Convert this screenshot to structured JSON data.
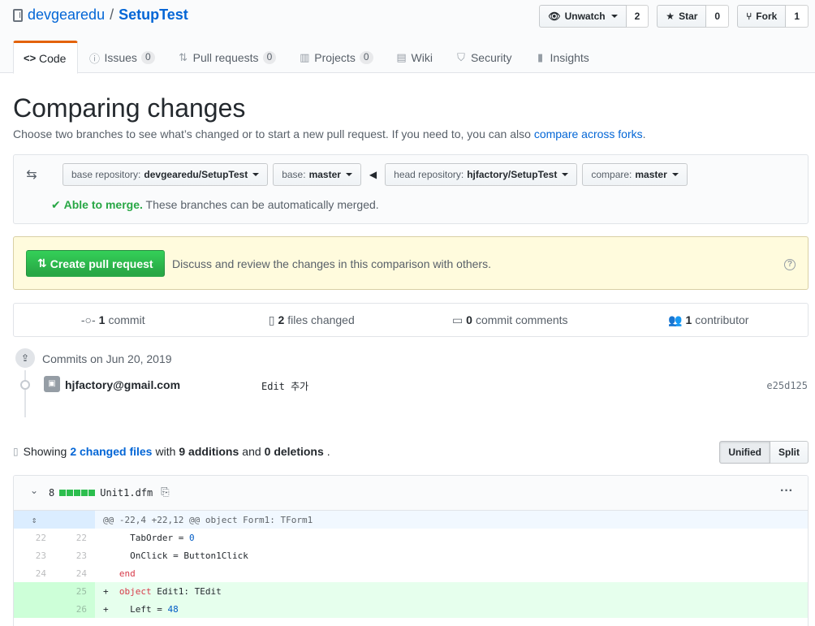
{
  "repo": {
    "owner": "devgearedu",
    "separator": "/",
    "name": "SetupTest"
  },
  "actions": [
    {
      "label": "Unwatch",
      "icon": "eye-icon",
      "count": "2"
    },
    {
      "label": "Star",
      "icon": "star-icon",
      "count": "0"
    },
    {
      "label": "Fork",
      "icon": "fork-icon",
      "count": "1"
    }
  ],
  "nav": {
    "code": "Code",
    "issues": "Issues",
    "issues_count": "0",
    "pulls": "Pull requests",
    "pulls_count": "0",
    "projects": "Projects",
    "projects_count": "0",
    "wiki": "Wiki",
    "security": "Security",
    "insights": "Insights"
  },
  "compare": {
    "title": "Comparing changes",
    "desc": "Choose two branches to see what’s changed or to start a new pull request. If you need to, you can also",
    "desc_link": "compare across forks",
    "desc_end": "."
  },
  "range": {
    "base_repo_label": "base repository:",
    "base_repo": "devgearedu/SetupTest",
    "base_label": "base:",
    "base": "master",
    "head_repo_label": "head repository:",
    "head_repo": "hjfactory/SetupTest",
    "compare_label": "compare:",
    "compare": "master",
    "merge_ok": "Able to merge.",
    "merge_text": "These branches can be automatically merged."
  },
  "flash": {
    "button": "Create pull request",
    "text": "Discuss and review the changes in this comparison with others."
  },
  "summary": {
    "commits_n": "1",
    "commits_label": "commit",
    "files_n": "2",
    "files_label": "files changed",
    "comments_n": "0",
    "comments_label": "commit comments",
    "contributors_n": "1",
    "contributors_label": "contributor"
  },
  "commits": {
    "date": "Commits on Jun 20, 2019",
    "author": "hjfactory@gmail.com",
    "message": "Edit 추가",
    "sha": "e25d125"
  },
  "toc": {
    "showing": "Showing",
    "changed_files": "2 changed files",
    "with": "with",
    "additions": "9 additions",
    "and": "and",
    "deletions": "0 deletions",
    "end": ".",
    "unified": "Unified",
    "split": "Split"
  },
  "file": {
    "changes": "8",
    "name": "Unit1.dfm",
    "hunk": "@@ -22,4 +22,12 @@ object Form1: TForm1",
    "lines": [
      {
        "type": "ctx",
        "old": "22",
        "new": "22",
        "prefix": " ",
        "indent": "    ",
        "parts": [
          {
            "t": "TabOrder = "
          },
          {
            "t": "0",
            "c": "nr"
          }
        ]
      },
      {
        "type": "ctx",
        "old": "23",
        "new": "23",
        "prefix": " ",
        "indent": "    ",
        "parts": [
          {
            "t": "OnClick = Button1Click"
          }
        ]
      },
      {
        "type": "ctx",
        "old": "24",
        "new": "24",
        "prefix": " ",
        "indent": "  ",
        "parts": [
          {
            "t": "end",
            "c": "kw"
          }
        ]
      },
      {
        "type": "add",
        "old": "",
        "new": "25",
        "prefix": "+",
        "indent": "  ",
        "parts": [
          {
            "t": "object",
            "c": "kw"
          },
          {
            "t": " Edit1: TEdit"
          }
        ]
      },
      {
        "type": "add",
        "old": "",
        "new": "26",
        "prefix": "+",
        "indent": "    ",
        "parts": [
          {
            "t": "Left = "
          },
          {
            "t": "48",
            "c": "nr"
          }
        ]
      }
    ]
  }
}
